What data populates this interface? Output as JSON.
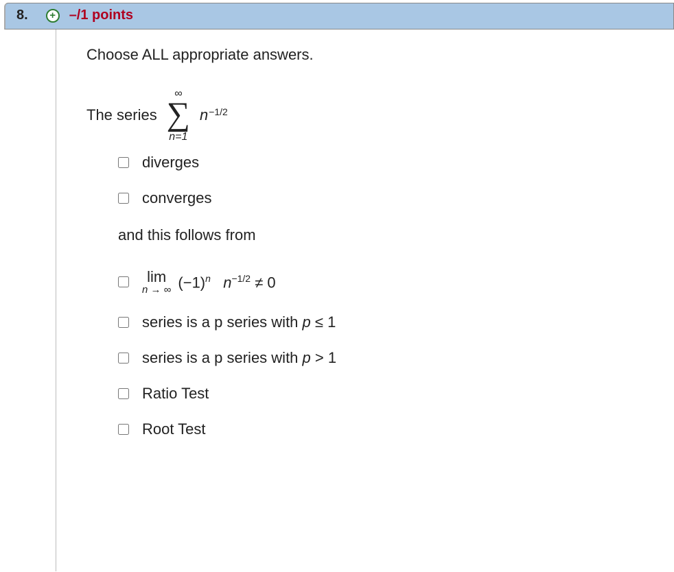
{
  "header": {
    "number": "8.",
    "points": "–/1 points"
  },
  "content": {
    "instruction": "Choose ALL appropriate answers.",
    "series_label_prefix": "The series",
    "sigma": {
      "upper": "∞",
      "lower": "n=1"
    },
    "series_term_base": "n",
    "series_term_exp": "−1/2",
    "choices_group1": [
      "diverges",
      "converges"
    ],
    "follows_label": "and this follows from",
    "limit_choice": {
      "lim_text": "lim",
      "lim_sub_lhs": "n",
      "lim_sub_arrow": " → ",
      "lim_sub_rhs": "∞",
      "base1": "(−1)",
      "exp1": "n",
      "base2": "n",
      "exp2": "−1/2",
      "tail": " ≠ 0"
    },
    "choices_group2": [
      {
        "pre": "series is a p series with ",
        "var": "p",
        "post": " ≤ 1"
      },
      {
        "pre": "series is a p series with ",
        "var": "p",
        "post": " > 1"
      },
      {
        "pre": "Ratio Test",
        "var": "",
        "post": ""
      },
      {
        "pre": "Root Test",
        "var": "",
        "post": ""
      }
    ]
  }
}
